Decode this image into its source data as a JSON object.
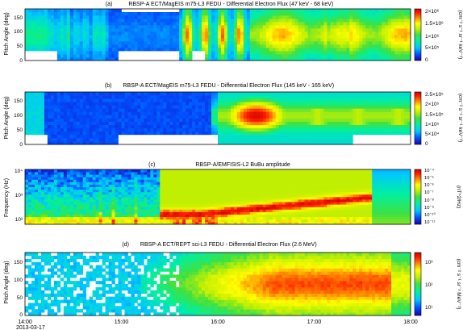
{
  "chart_data": [
    {
      "type": "heatmap",
      "panel_letter": "(a)",
      "title": "RBSP-A ECT/MagEIS m75-L3  FEDU - Differential Electron Flux  (47 keV - 68 keV)",
      "ylabel": "Pitch Angle (deg)",
      "ylim": [
        0,
        180
      ],
      "yticks": [
        "0",
        "50",
        "100",
        "150"
      ],
      "colorbar": {
        "scale": "linear",
        "ticks": [
          "0",
          "5×10⁵",
          "1×10⁶",
          "1.5×10⁶",
          "2×10⁶"
        ],
        "units": "(cm⁻² s⁻¹ sr⁻¹ keV⁻¹)"
      }
    },
    {
      "type": "heatmap",
      "panel_letter": "(b)",
      "title": "RBSP-A ECT/MagEIS m75-L3  FEDU - Differential Electron Flux  (145 keV - 165 keV)",
      "ylabel": "Pitch Angle (deg)",
      "ylim": [
        0,
        180
      ],
      "yticks": [
        "0",
        "50",
        "100",
        "150"
      ],
      "colorbar": {
        "scale": "linear",
        "ticks": [
          "0",
          "5×10⁴",
          "1×10⁵",
          "1.5×10⁵",
          "2×10⁵",
          "2.5×10⁵"
        ],
        "units": "(cm⁻² s⁻¹ sr⁻¹ keV⁻¹)"
      }
    },
    {
      "type": "heatmap",
      "panel_letter": "(c)",
      "title": "RBSP-A/EMFISIS-L2  BuBu amplitude",
      "ylabel": "Frequency (Hz)",
      "yscale": "log",
      "ylim": [
        50,
        10000
      ],
      "yticks": [
        "10²",
        "10³",
        "10⁴"
      ],
      "colorbar": {
        "scale": "log",
        "ticks": [
          "10⁻¹¹",
          "10⁻¹⁰",
          "10⁻⁹",
          "10⁻⁸",
          "10⁻⁷",
          "10⁻⁶",
          "10⁻⁵",
          "10⁻⁴"
        ],
        "units": "(nT^2/Hz)"
      }
    },
    {
      "type": "heatmap",
      "panel_letter": "(d)",
      "title": "RBSP-A ECT/REPT sci-L3  FEDU - Differential Electron Flux   (2.6 MeV)",
      "ylabel": "Pitch Angle (deg)",
      "ylim": [
        0,
        180
      ],
      "yticks": [
        "0",
        "50",
        "100",
        "150"
      ],
      "colorbar": {
        "scale": "log",
        "ticks": [
          "10¹",
          "10²",
          "10³"
        ],
        "units": "(cm⁻² s⁻¹ sr⁻¹ MeV⁻¹)"
      }
    }
  ],
  "time_axis": {
    "ticks": [
      "14:00",
      "15:00",
      "16:00",
      "17:00",
      "18:00"
    ],
    "date": "2013-03-17"
  },
  "colormap": [
    "#1a00b0",
    "#0050ff",
    "#00c8ff",
    "#00f0a0",
    "#40e040",
    "#c8f000",
    "#ffff00",
    "#ff9000",
    "#ff2000",
    "#d00000"
  ]
}
